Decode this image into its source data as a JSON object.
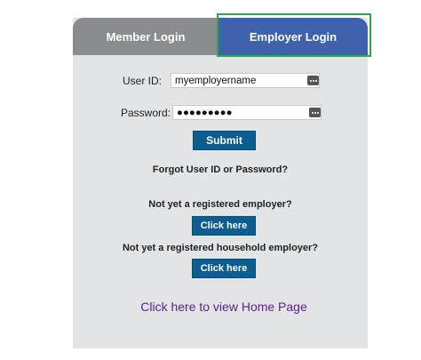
{
  "tabs": {
    "member_label": "Member Login",
    "employer_label": "Employer Login"
  },
  "form": {
    "user_id_label": "User ID:",
    "user_id_value": "myemployername",
    "password_label": "Password:",
    "password_value": "●●●●●●●●●",
    "submit_label": "Submit",
    "forgot_label": "Forgot User ID or Password?"
  },
  "registration": {
    "employer_prompt": "Not yet a registered employer?",
    "employer_button": "Click here",
    "household_prompt": "Not yet a registered household employer?",
    "household_button": "Click here"
  },
  "home_link": "Click here to view Home Page",
  "colors": {
    "active_tab": "#3f62ae",
    "inactive_tab": "#8a8c90",
    "button": "#0b5e8f",
    "link": "#5a1e8a",
    "highlight": "#2ea84a"
  }
}
